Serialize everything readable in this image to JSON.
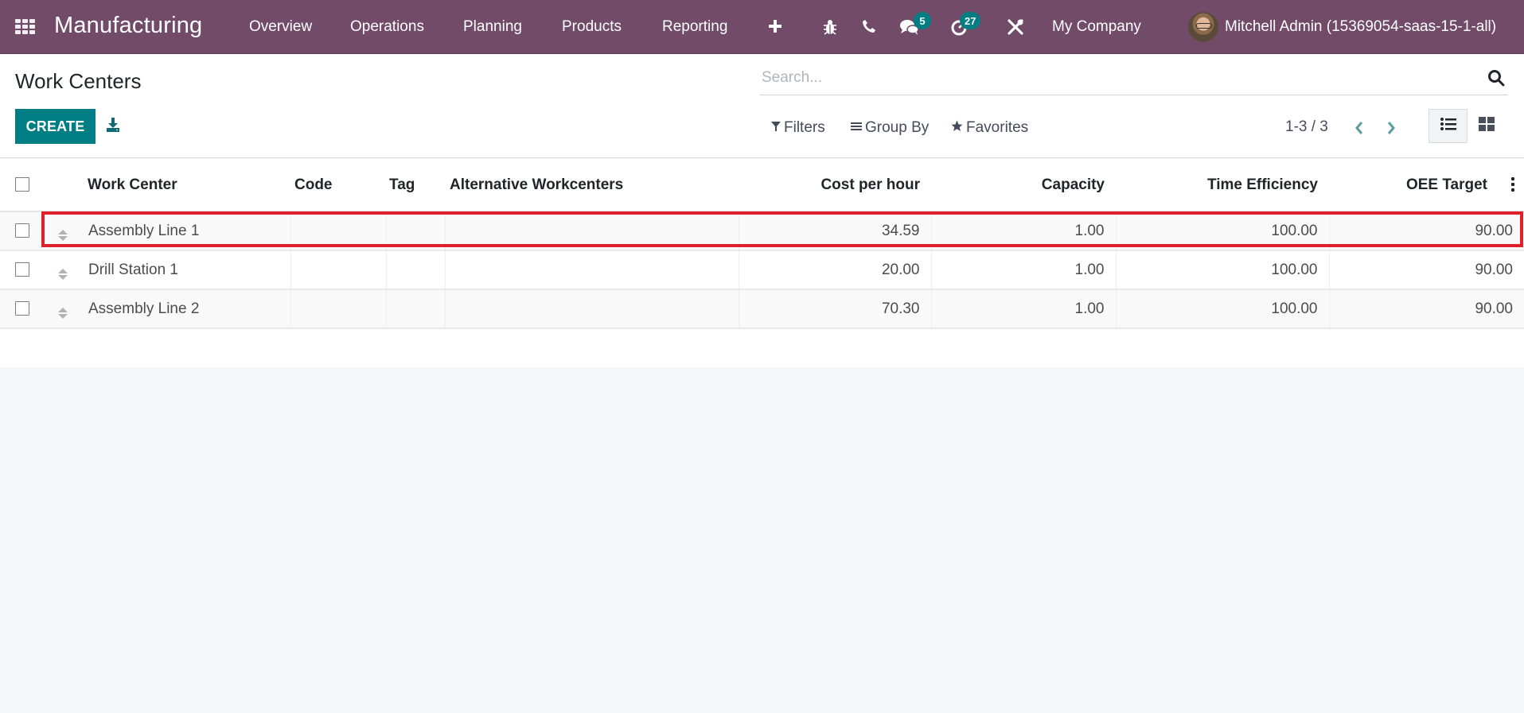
{
  "navbar": {
    "app_name": "Manufacturing",
    "menu": [
      "Overview",
      "Operations",
      "Planning",
      "Products",
      "Reporting"
    ],
    "icons": [
      "apps-grid-icon",
      "plus-icon",
      "bug-icon",
      "phone-icon",
      "chat-icon",
      "activity-clock-icon",
      "tools-icon"
    ],
    "messages_badge": "5",
    "activities_badge": "27",
    "company": "My Company",
    "user": "Mitchell Admin (15369054-saas-15-1-all)",
    "colors": {
      "navbar": "#714b67",
      "badge": "#017e84"
    }
  },
  "control_panel": {
    "title": "Work Centers",
    "create_label": "CREATE",
    "search_placeholder": "Search...",
    "filters_label": "Filters",
    "group_by_label": "Group By",
    "favorites_label": "Favorites",
    "pager": "1-3 / 3",
    "views": [
      "list",
      "kanban"
    ],
    "active_view": "list",
    "colors": {
      "primary": "#017e84"
    }
  },
  "table": {
    "columns": [
      "Work Center",
      "Code",
      "Tag",
      "Alternative Workcenters",
      "Cost per hour",
      "Capacity",
      "Time Efficiency",
      "OEE Target"
    ],
    "rows": [
      {
        "work_center": "Assembly Line 1",
        "code": "",
        "tag": "",
        "alternative": "",
        "cost_per_hour": "34.59",
        "capacity": "1.00",
        "time_efficiency": "100.00",
        "oee_target": "90.00",
        "highlighted": true
      },
      {
        "work_center": "Drill Station 1",
        "code": "",
        "tag": "",
        "alternative": "",
        "cost_per_hour": "20.00",
        "capacity": "1.00",
        "time_efficiency": "100.00",
        "oee_target": "90.00",
        "highlighted": false
      },
      {
        "work_center": "Assembly Line 2",
        "code": "",
        "tag": "",
        "alternative": "",
        "cost_per_hour": "70.30",
        "capacity": "1.00",
        "time_efficiency": "100.00",
        "oee_target": "90.00",
        "highlighted": false
      }
    ],
    "highlight_color": "#e0202b"
  }
}
